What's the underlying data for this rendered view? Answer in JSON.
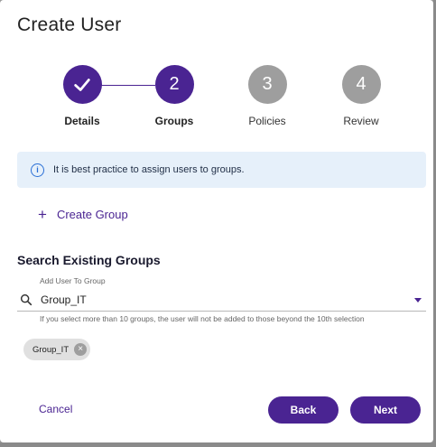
{
  "dialog": {
    "title": "Create User"
  },
  "stepper": {
    "steps": [
      {
        "number": "✓",
        "label": "Details",
        "state": "completed"
      },
      {
        "number": "2",
        "label": "Groups",
        "state": "active"
      },
      {
        "number": "3",
        "label": "Policies",
        "state": "pending"
      },
      {
        "number": "4",
        "label": "Review",
        "state": "pending"
      }
    ]
  },
  "info_banner": {
    "icon": "info-icon",
    "text": "It is best practice to assign users to groups."
  },
  "create_group": {
    "icon": "plus-icon",
    "label": "Create Group"
  },
  "search_section": {
    "title": "Search Existing Groups",
    "field_label": "Add User To Group",
    "value": "Group_IT",
    "helper": "If you select more than 10 groups, the user will not be added to those beyond the 10th selection"
  },
  "selected_chips": [
    {
      "label": "Group_IT"
    }
  ],
  "footer": {
    "cancel_label": "Cancel",
    "back_label": "Back",
    "next_label": "Next"
  },
  "colors": {
    "primary": "#4a2492",
    "pending_step": "#9e9e9e",
    "info_bg": "#e6f0fa",
    "info_icon": "#2a6fd6"
  }
}
